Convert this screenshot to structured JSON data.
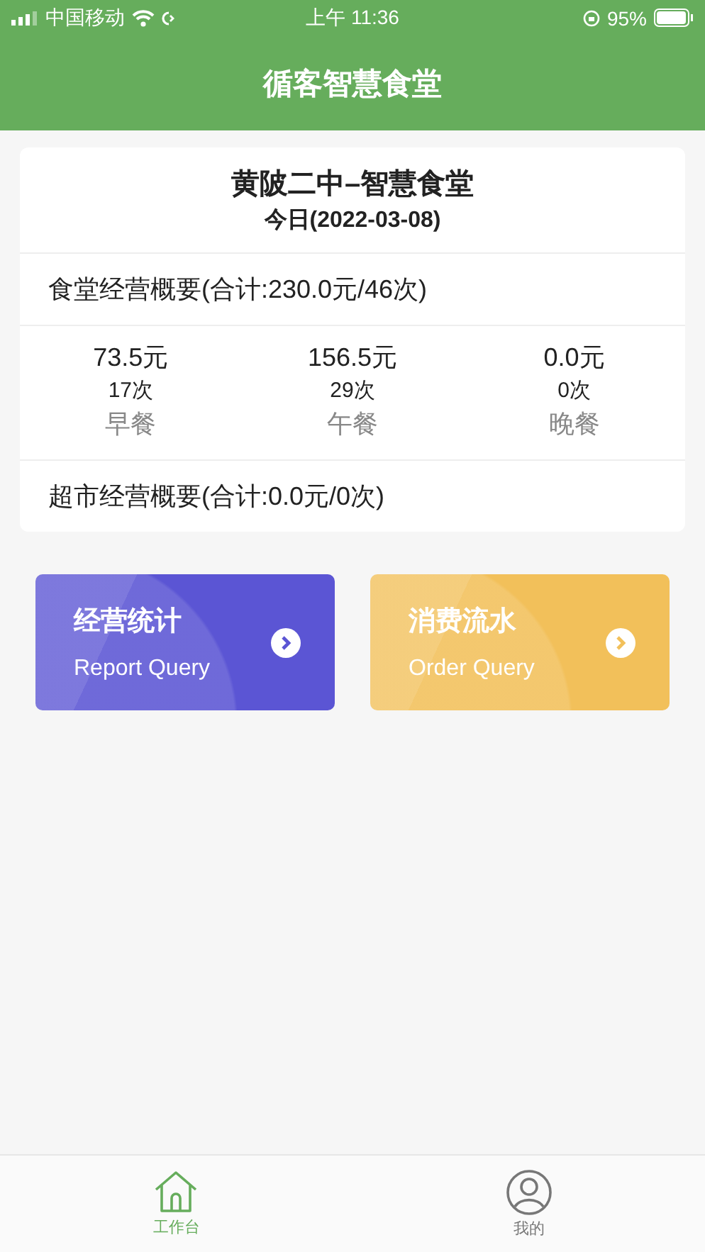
{
  "status_bar": {
    "carrier": "中国移动",
    "time": "上午 11:36",
    "battery": "95%"
  },
  "header": {
    "title": "循客智慧食堂"
  },
  "summary": {
    "school": "黄陂二中–智慧食堂",
    "date": "今日(2022-03-08)",
    "canteen_total": "食堂经营概要(合计:230.0元/46次)",
    "meals": [
      {
        "amount": "73.5元",
        "count": "17次",
        "name": "早餐"
      },
      {
        "amount": "156.5元",
        "count": "29次",
        "name": "午餐"
      },
      {
        "amount": "0.0元",
        "count": "0次",
        "name": "晚餐"
      }
    ],
    "market_total": "超市经营概要(合计:0.0元/0次)"
  },
  "tiles": [
    {
      "title": "经营统计",
      "subtitle": "Report Query",
      "color": "#5b55d4"
    },
    {
      "title": "消费流水",
      "subtitle": "Order Query",
      "color": "#f2c05a"
    }
  ],
  "tabs": [
    {
      "label": "工作台",
      "selected": true,
      "kind": "home"
    },
    {
      "label": "我的",
      "selected": false,
      "kind": "profile"
    }
  ]
}
